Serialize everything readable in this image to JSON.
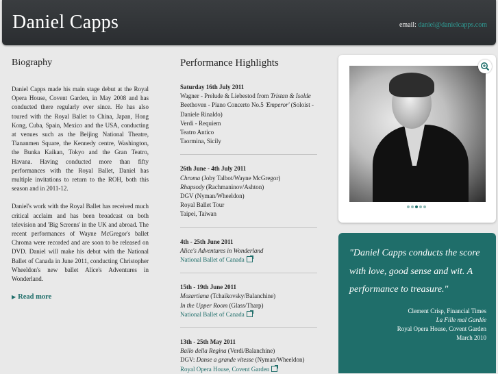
{
  "header": {
    "title": "Daniel Capps",
    "email_label": "email:",
    "email_address": "daniel@danielcapps.com"
  },
  "biography": {
    "heading": "Biography",
    "paragraph1": "Daniel Capps made his main stage debut at the Royal Opera House, Covent Garden, in May 2008 and has conducted there regularly ever since. He has also toured with the Royal Ballet to China, Japan, Hong Kong, Cuba, Spain, Mexico and the USA, conducting at venues such as the Beijing National Theatre, Tiananmen Square, the Kennedy centre, Washington, the Bunka Kaikan, Tokyo and the Gran Teatro, Havana. Having conducted more than fifty performances with the Royal Ballet, Daniel has multiple invitations to return to the ROH, both this season and in 2011-12.",
    "paragraph2": "Daniel's work with the Royal Ballet has received much critical acclaim and has been broadcast on both television and 'Big Screens' in the UK and abroad. The recent performances of Wayne McGregor's ballet Chroma were recorded and are soon to be released on DVD. Daniel will make his debut with the National Ballet of Canada in June 2011, conducting Christopher Wheeldon's new ballet Alice's Adventures in Wonderland.",
    "read_more": "Read more"
  },
  "highlights": {
    "heading": "Performance Highlights",
    "items": [
      {
        "date": "Saturday 16th July 2011",
        "l1a": "Wagner - Prelude & Liebestod from ",
        "l1b": "Tristan & Isolde",
        "l2a": "Beethoven - Piano Concerto No.5 ",
        "l2b": "'Emperor'",
        "l2c": " (Soloist - Daniele Rinaldo)",
        "l3": "Verdi - Requiem",
        "l4": "Teatro Antico",
        "l5": "Taormina, Sicily"
      },
      {
        "date": "26th June - 4th July 2011",
        "l1a": "Chroma",
        "l1b": " (Joby Talbot/Wayne McGregor)",
        "l2a": "Rhapsody",
        "l2b": " (Rachmaninov/Ashton)",
        "l3": "DGV (Nyman/Wheeldon)",
        "l4": "Royal Ballet Tour",
        "l5": "Taipei, Taiwan"
      },
      {
        "date": "4th - 25th June 2011",
        "l1": "Alice's Adventures in Wonderland",
        "venue": "National Ballet of Canada"
      },
      {
        "date": "15th - 19th June 2011",
        "l1a": "Mozartiana",
        "l1b": " (Tchaikovsky/Balanchine)",
        "l2a": "In the Upper Room",
        "l2b": " (Glass/Tharp)",
        "venue": "National Ballet of Canada"
      },
      {
        "date": "13th - 25th May 2011",
        "l1a": "Ballo della Regina",
        "l1b": " (Verdi/Balanchine)",
        "l2a": "DGV: ",
        "l2b": "Danse a grande vitesse",
        "l2c": " (Nyman/Wheeldon)",
        "venue": "Royal Opera House, Covent Garden"
      }
    ]
  },
  "gallery": {
    "zoom_icon": "zoom-in-icon",
    "slide_count": 5,
    "active_slide": 2
  },
  "quote": {
    "text": "\"Daniel Capps conducts the score with love, good sense and wit. A performance to treasure.\"",
    "author": "Clement Crisp, Financial Times",
    "work": "La Fille mal Gardée",
    "venue": "Royal Opera House, Covent Garden",
    "date": "March 2010"
  },
  "colors": {
    "accent": "#1f6e6a",
    "header_bg": "#2f3235",
    "page_bg": "#e9e9e9"
  }
}
